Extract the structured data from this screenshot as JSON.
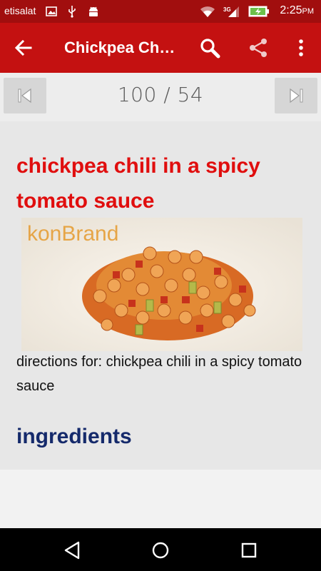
{
  "status_bar": {
    "carrier": "etisalat",
    "network": "3G",
    "time": "2:25",
    "time_suffix": "PM",
    "icons": [
      "image-notification-icon",
      "usb-icon",
      "android-debug-icon",
      "wifi-icon",
      "signal-icon",
      "battery-charging-icon"
    ]
  },
  "app_bar": {
    "title": "Chickpea Ch…",
    "back_icon": "arrow-left-icon",
    "actions": [
      "search-icon",
      "share-icon",
      "more-vert-icon"
    ],
    "color": "#c41111"
  },
  "pager": {
    "position": "100 / 54",
    "first_icon": "skip-first-icon",
    "last_icon": "skip-last-icon"
  },
  "recipe": {
    "title": "chickpea chili in a spicy tomato sauce",
    "image_watermark": "konBrand",
    "directions": "directions for: chickpea chili in a spicy tomato sauce",
    "ingredients_heading": "ingredients"
  },
  "nav_bar": {
    "buttons": [
      "back-triangle-icon",
      "home-circle-icon",
      "recents-square-icon"
    ]
  }
}
